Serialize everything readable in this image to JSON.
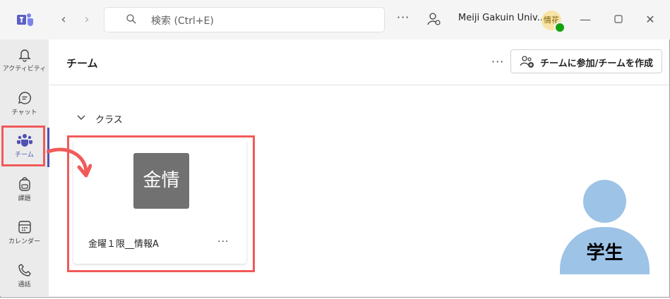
{
  "titlebar": {
    "search_placeholder": "検索 (Ctrl+E)",
    "more": "···",
    "org_name": "Meiji Gakuin Univ...",
    "avatar_initials": "情花",
    "presence_color": "#13a10e"
  },
  "rail": {
    "items": [
      {
        "label": "アクティビティ",
        "icon": "bell-icon"
      },
      {
        "label": "チャット",
        "icon": "chat-icon"
      },
      {
        "label": "チーム",
        "icon": "teams-icon",
        "active": true
      },
      {
        "label": "課題",
        "icon": "backpack-icon"
      },
      {
        "label": "カレンダー",
        "icon": "calendar-icon"
      },
      {
        "label": "通話",
        "icon": "phone-icon"
      }
    ]
  },
  "header": {
    "title": "チーム",
    "more": "···",
    "join_button": "チームに参加/チームを作成"
  },
  "section": {
    "label": "クラス"
  },
  "team_card": {
    "tile_text": "金情",
    "name": "金曜１限__情報A",
    "more": "···",
    "tile_color": "#717171"
  },
  "annotation": {
    "student_label": "学生",
    "highlight_color": "#f15a5a",
    "figure_color": "#9dc3e6"
  }
}
